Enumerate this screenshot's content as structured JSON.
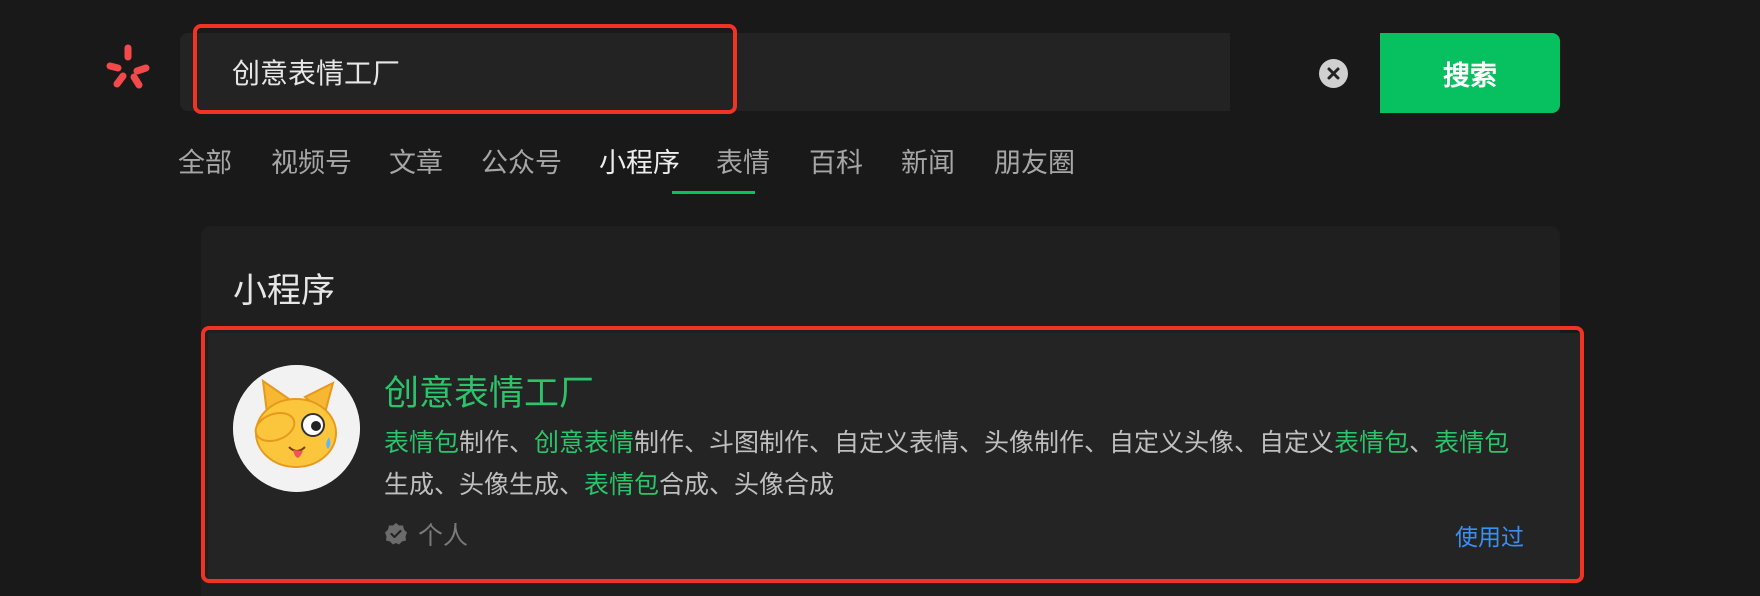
{
  "search": {
    "query": "创意表情工厂",
    "button_label": "搜索"
  },
  "tabs": [
    {
      "label": "全部"
    },
    {
      "label": "视频号"
    },
    {
      "label": "文章"
    },
    {
      "label": "公众号"
    },
    {
      "label": "小程序"
    },
    {
      "label": "表情"
    },
    {
      "label": "百科"
    },
    {
      "label": "新闻"
    },
    {
      "label": "朋友圈"
    }
  ],
  "active_tab": "小程序",
  "section": {
    "title": "小程序"
  },
  "result": {
    "name": "创意表情工厂",
    "description": {
      "segments": [
        {
          "text": "表情包",
          "highlight": true
        },
        {
          "text": "制作、",
          "highlight": false
        },
        {
          "text": "创意表情",
          "highlight": true
        },
        {
          "text": "制作、斗图制作、自定义表情、头像制作、自定义头像、自定义",
          "highlight": false
        },
        {
          "text": "表情包",
          "highlight": true
        },
        {
          "text": "、",
          "highlight": false
        },
        {
          "text": "表情包",
          "highlight": true
        },
        {
          "text": "生成、头像生成、",
          "highlight": false
        },
        {
          "text": "表情包",
          "highlight": true
        },
        {
          "text": "合成、头像合成",
          "highlight": false
        }
      ]
    },
    "verification": "个人",
    "used_label": "使用过"
  },
  "colors": {
    "accent_green": "#07c160",
    "highlight_green": "#2cc46a",
    "link_blue": "#3a8ff3",
    "annotation_red": "#f03324"
  }
}
